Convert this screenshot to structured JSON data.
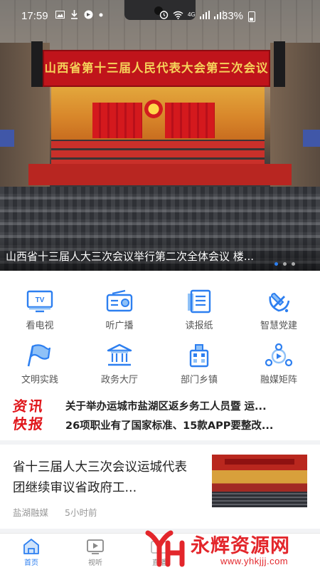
{
  "status_bar": {
    "time": "17:59",
    "battery": "33%",
    "network": "4G"
  },
  "hero": {
    "banner_text": "山西省第十三届人民代表大会第三次会议",
    "caption": "山西省十三届人大三次会议举行第二次全体会议 楼...",
    "slide_count": 3,
    "active_slide": 1
  },
  "quick_menu": {
    "items": [
      {
        "label": "看电视",
        "icon": "tv-icon"
      },
      {
        "label": "听广播",
        "icon": "radio-icon"
      },
      {
        "label": "读报纸",
        "icon": "newspaper-icon"
      },
      {
        "label": "智慧党建",
        "icon": "party-emblem-icon"
      },
      {
        "label": "文明实践",
        "icon": "flag-icon"
      },
      {
        "label": "政务大厅",
        "icon": "government-hall-icon"
      },
      {
        "label": "部门乡镇",
        "icon": "building-icon"
      },
      {
        "label": "融媒矩阵",
        "icon": "media-matrix-icon"
      }
    ],
    "accent_color": "#2d7ff0"
  },
  "flash_news": {
    "logo_line1": "资讯",
    "logo_line2": "快报",
    "items": [
      "关于举办运城市盐湖区返乡务工人员暨 运...",
      "26项职业有了国家标准、15款APP要整改..."
    ]
  },
  "article": {
    "title": "省十三届人大三次会议运城代表团继续审议省政府工...",
    "source": "盐湖融媒",
    "time": "5小时前"
  },
  "bottom_nav": {
    "items": [
      {
        "label": "首页",
        "icon": "home-icon",
        "active": true
      },
      {
        "label": "视听",
        "icon": "video-icon",
        "active": false
      },
      {
        "label": "直播",
        "icon": "live-icon",
        "active": false
      }
    ]
  },
  "watermark": {
    "name": "永辉资源网",
    "url": "www.yhkjjj.com"
  }
}
